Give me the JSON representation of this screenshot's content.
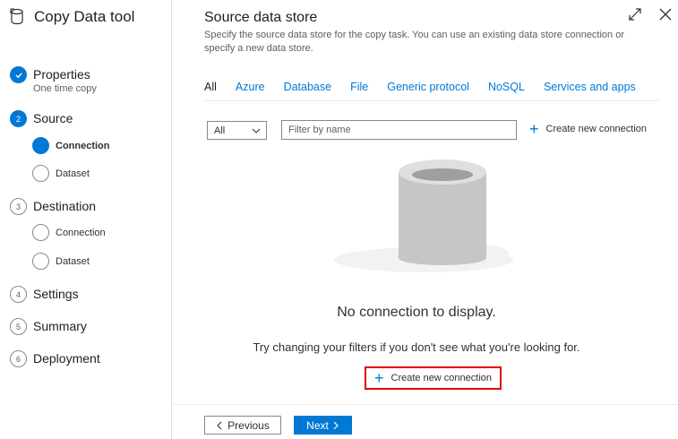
{
  "app": {
    "title": "Copy Data tool"
  },
  "steps": {
    "properties": {
      "label": "Properties",
      "sub": "One time copy"
    },
    "source": {
      "number": "2",
      "label": "Source",
      "connection": "Connection",
      "dataset": "Dataset"
    },
    "destination": {
      "number": "3",
      "label": "Destination",
      "connection": "Connection",
      "dataset": "Dataset"
    },
    "settings": {
      "number": "4",
      "label": "Settings"
    },
    "summary": {
      "number": "5",
      "label": "Summary"
    },
    "deployment": {
      "number": "6",
      "label": "Deployment"
    }
  },
  "main": {
    "title": "Source data store",
    "description": "Specify the source data store for the copy task. You can use an existing data store connection or specify a new data store."
  },
  "tabs": [
    "All",
    "Azure",
    "Database",
    "File",
    "Generic protocol",
    "NoSQL",
    "Services and apps"
  ],
  "filter": {
    "dropdown_value": "All",
    "placeholder": "Filter by name",
    "create_label": "Create new connection"
  },
  "empty": {
    "title": "No connection to display.",
    "hint": "Try changing your filters if you don't see what you're looking for.",
    "create_label": "Create new connection"
  },
  "footer": {
    "previous": "Previous",
    "next": "Next"
  },
  "colors": {
    "accent": "#0078d4",
    "highlight": "#e00000"
  }
}
